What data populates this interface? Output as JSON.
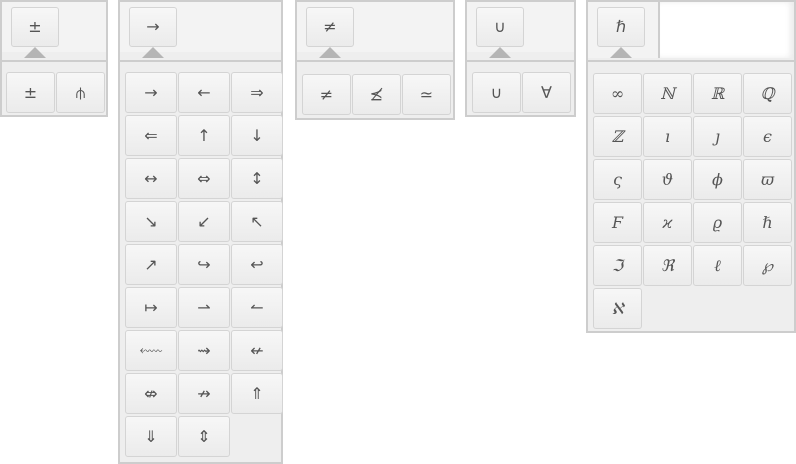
{
  "panels": [
    {
      "id": "plusminus",
      "trigger": "±",
      "cols": 2,
      "items": [
        "±",
        "⫛"
      ]
    },
    {
      "id": "arrows",
      "trigger": "→",
      "cols": 3,
      "items": [
        "→",
        "←",
        "⇒",
        "⇐",
        "↑",
        "↓",
        "↔",
        "⇔",
        "↕",
        "↘",
        "↙",
        "↖",
        "↗",
        "↪",
        "↩",
        "↦",
        "⇀",
        "↼",
        "⬳",
        "⇝",
        "↚",
        "⇎",
        "↛",
        "⇑",
        "⇓",
        "⇕"
      ]
    },
    {
      "id": "relations",
      "trigger": "≠",
      "cols": 3,
      "items": [
        "≠",
        "⪯̸",
        "≃"
      ]
    },
    {
      "id": "sets",
      "trigger": "∪",
      "cols": 2,
      "items": [
        "∪",
        "∀"
      ]
    },
    {
      "id": "letters",
      "trigger": "ℏ",
      "cols": 4,
      "items": [
        "∞",
        "ℕ",
        "ℝ",
        "ℚ",
        "ℤ",
        "ı",
        "ȷ",
        "ϵ",
        "ς",
        "ϑ",
        "ϕ",
        "ϖ",
        "Ϝ",
        "ϰ",
        "ϱ",
        "ℏ",
        "ℑ",
        "ℜ",
        "ℓ",
        "℘",
        "ℵ"
      ]
    }
  ]
}
